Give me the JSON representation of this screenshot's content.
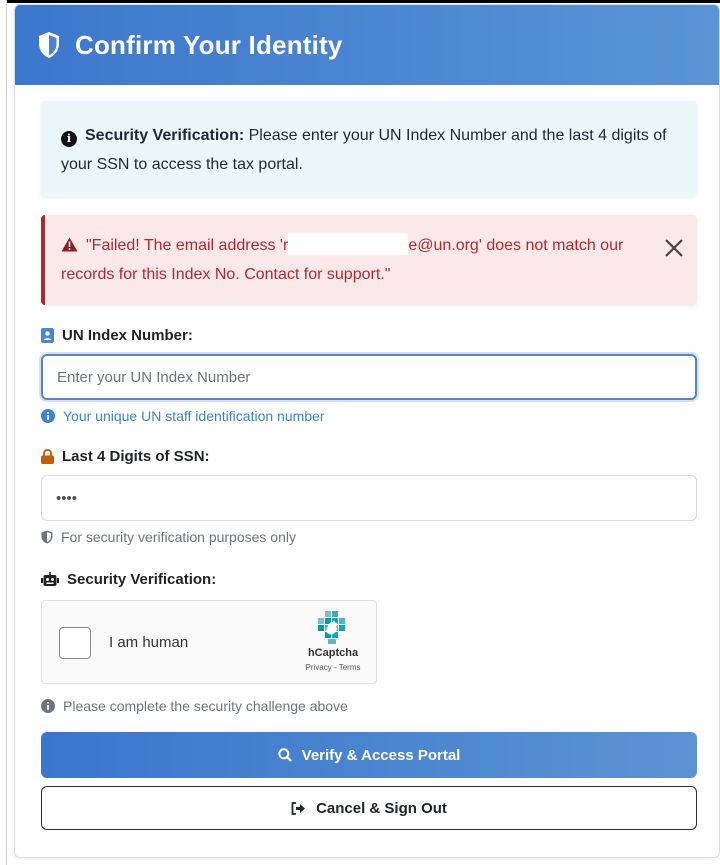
{
  "header": {
    "title": "Confirm Your Identity"
  },
  "info_alert": {
    "label": "Security Verification:",
    "text": " Please enter your UN Index Number and the last 4 digits of your SSN to access the tax portal."
  },
  "error_alert": {
    "text_before": "\"Failed! The email address 'r",
    "text_after": "e@un.org' does not match our records for this Index No. Contact for support.\""
  },
  "index_field": {
    "label": "UN Index Number:",
    "placeholder": "Enter your UN Index Number",
    "value": "",
    "help": "Your unique UN staff identification number"
  },
  "ssn_field": {
    "label": "Last 4 Digits of SSN:",
    "value": "••••",
    "help": "For security verification purposes only"
  },
  "captcha": {
    "label": "Security Verification:",
    "checkbox_text": "I am human",
    "brand": "hCaptcha",
    "links": "Privacy - Terms",
    "help": "Please complete the security challenge above"
  },
  "buttons": {
    "verify": "Verify & Access Portal",
    "cancel": "Cancel & Sign Out"
  },
  "colors": {
    "header_start": "#3c77cc",
    "header_end": "#5a94d6",
    "error_text": "#b2282f",
    "help_blue": "#3a86c8",
    "lock_orange": "#c45d0e"
  },
  "icons": [
    "shield-icon",
    "info-circle-icon",
    "warning-triangle-icon",
    "close-icon",
    "id-badge-icon",
    "lock-icon",
    "robot-icon",
    "search-icon",
    "sign-out-icon",
    "hcaptcha-logo-icon"
  ]
}
